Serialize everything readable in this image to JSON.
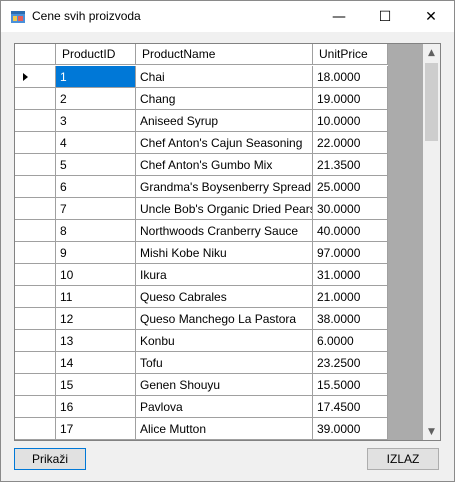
{
  "window": {
    "title": "Cene svih proizvoda"
  },
  "caption_buttons": {
    "minimize": "—",
    "maximize": "☐",
    "close": "✕"
  },
  "grid": {
    "columns": [
      "ProductID",
      "ProductName",
      "UnitPrice"
    ],
    "rows": [
      [
        "1",
        "Chai",
        "18.0000"
      ],
      [
        "2",
        "Chang",
        "19.0000"
      ],
      [
        "3",
        "Aniseed Syrup",
        "10.0000"
      ],
      [
        "4",
        "Chef Anton's Cajun Seasoning",
        "22.0000"
      ],
      [
        "5",
        "Chef Anton's Gumbo Mix",
        "21.3500"
      ],
      [
        "6",
        "Grandma's Boysenberry Spread",
        "25.0000"
      ],
      [
        "7",
        "Uncle Bob's Organic Dried Pears",
        "30.0000"
      ],
      [
        "8",
        "Northwoods Cranberry Sauce",
        "40.0000"
      ],
      [
        "9",
        "Mishi Kobe Niku",
        "97.0000"
      ],
      [
        "10",
        "Ikura",
        "31.0000"
      ],
      [
        "11",
        "Queso Cabrales",
        "21.0000"
      ],
      [
        "12",
        "Queso Manchego La Pastora",
        "38.0000"
      ],
      [
        "13",
        "Konbu",
        "6.0000"
      ],
      [
        "14",
        "Tofu",
        "23.2500"
      ],
      [
        "15",
        "Genen Shouyu",
        "15.5000"
      ],
      [
        "16",
        "Pavlova",
        "17.4500"
      ],
      [
        "17",
        "Alice Mutton",
        "39.0000"
      ]
    ],
    "selected_row": 0,
    "scroll_up": "▲",
    "scroll_down": "▼"
  },
  "buttons": {
    "prikazi": "Prikaži",
    "izlaz": "IZLAZ"
  },
  "colors": {
    "selection": "#0078d7",
    "grid_background": "#ababab"
  }
}
